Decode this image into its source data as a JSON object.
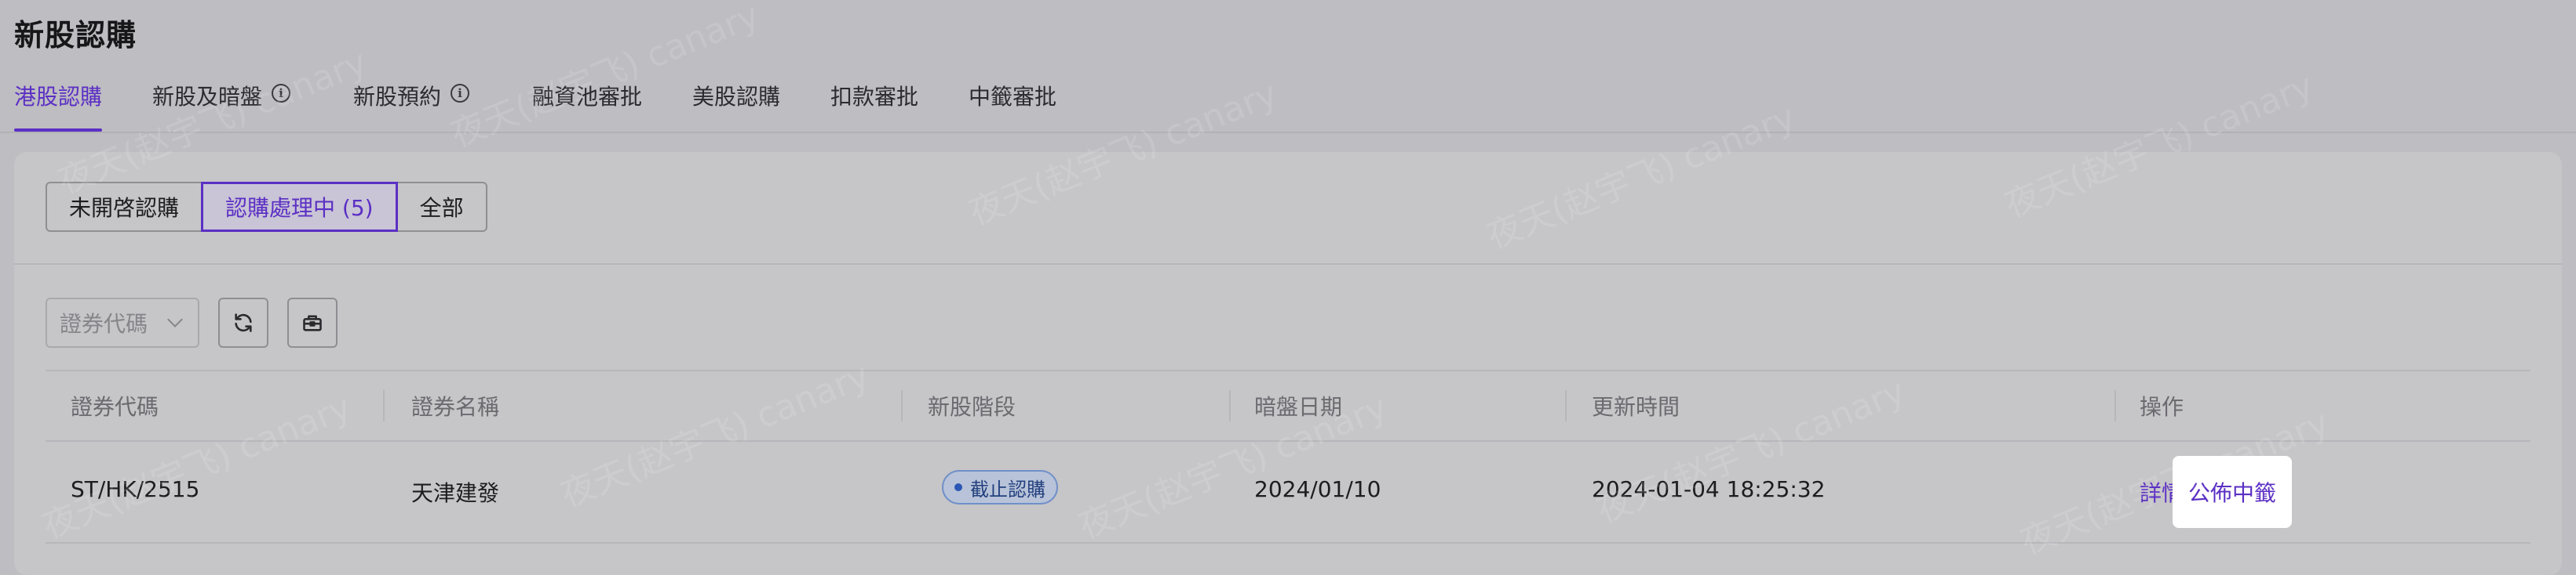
{
  "page": {
    "title": "新股認購"
  },
  "tabs": [
    {
      "label": "港股認購",
      "active": true,
      "info": false
    },
    {
      "label": "新股及暗盤",
      "active": false,
      "info": true
    },
    {
      "label": "新股預約",
      "active": false,
      "info": true
    },
    {
      "label": "融資池審批",
      "active": false,
      "info": false
    },
    {
      "label": "美股認購",
      "active": false,
      "info": false
    },
    {
      "label": "扣款審批",
      "active": false,
      "info": false
    },
    {
      "label": "中籤審批",
      "active": false,
      "info": false
    }
  ],
  "filters": [
    {
      "label": "未開啓認購",
      "active": false
    },
    {
      "label": "認購處理中 (5)",
      "active": true
    },
    {
      "label": "全部",
      "active": false
    }
  ],
  "toolbar": {
    "code_select_placeholder": "證券代碼",
    "refresh_icon": "refresh-icon",
    "settings_icon": "toolbox-icon"
  },
  "table": {
    "columns": [
      "證券代碼",
      "證券名稱",
      "新股階段",
      "暗盤日期",
      "更新時間",
      "操作"
    ],
    "rows": [
      {
        "code": "ST/HK/2515",
        "name": "天津建發",
        "stage": "截止認購",
        "grey_date": "2024/01/10",
        "updated": "2024-01-04 18:25:32",
        "actions": [
          "詳情",
          "公佈中籤"
        ]
      }
    ]
  },
  "watermark": {
    "text": "夜天(赵宇飞) canary"
  },
  "colors": {
    "accent": "#5b2fc4",
    "badge_border": "#6f8fc8",
    "badge_text": "#23407e"
  }
}
